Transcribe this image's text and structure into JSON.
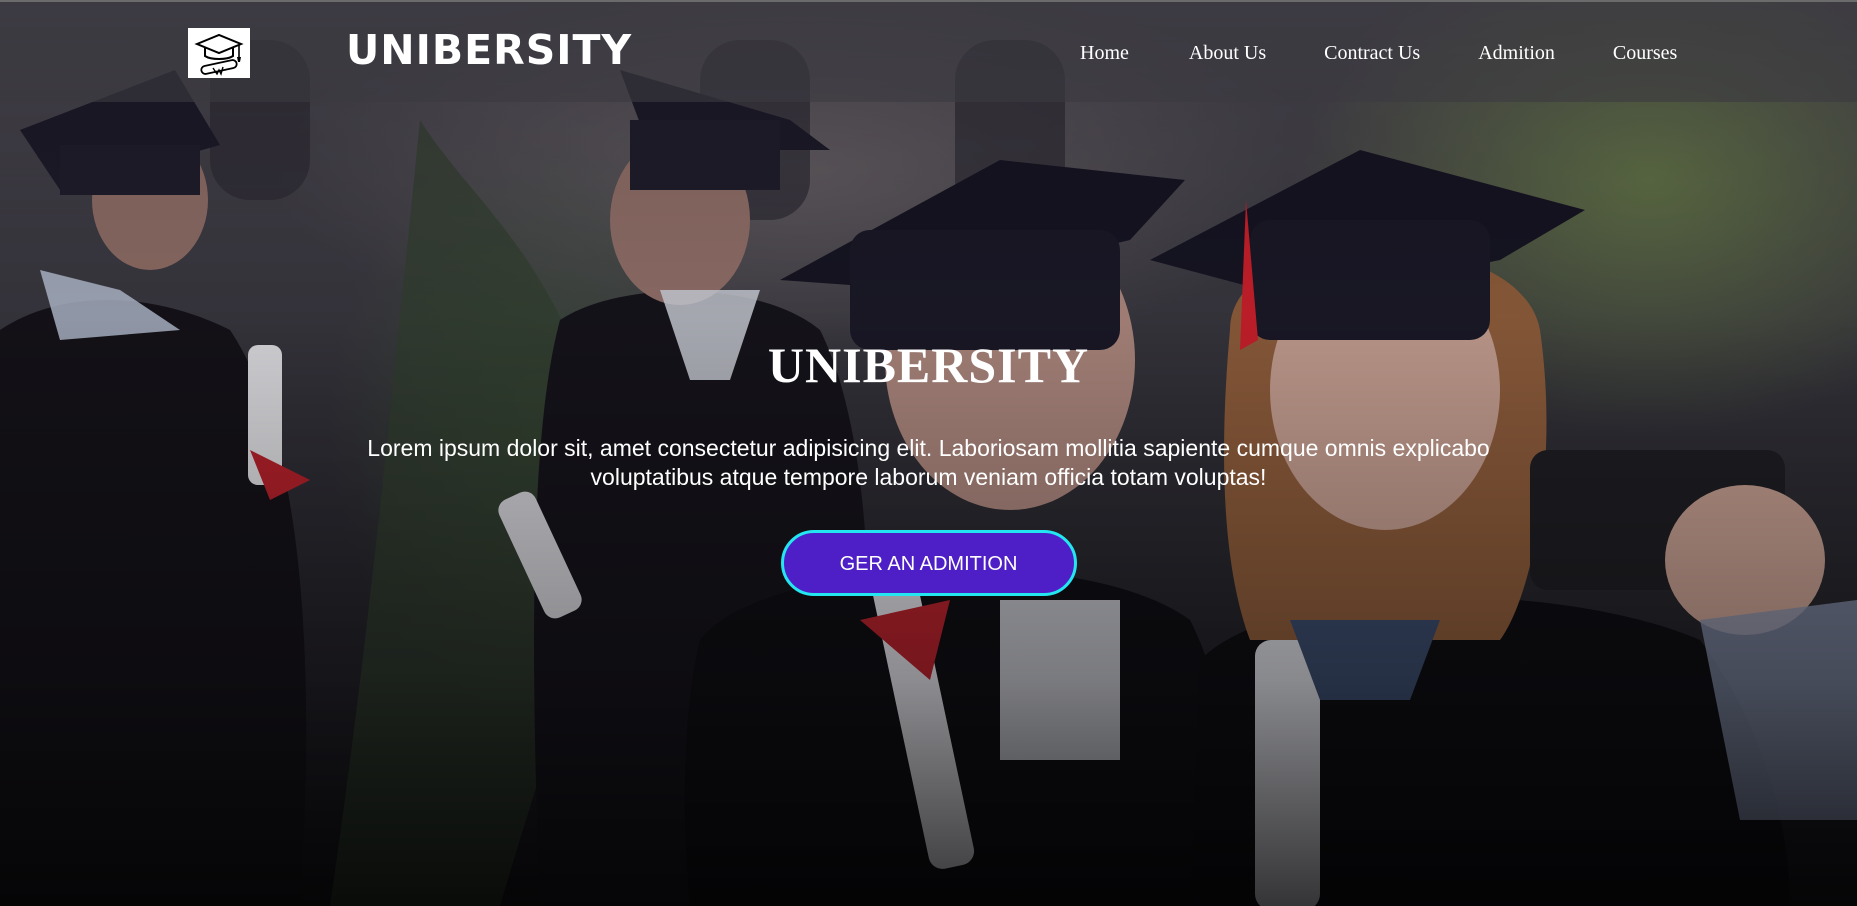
{
  "navbar": {
    "logo_icon": "graduation-cap-diploma-icon",
    "brand": "UNIBERSITY",
    "links": [
      {
        "label": "Home"
      },
      {
        "label": "About Us"
      },
      {
        "label": "Contract Us"
      },
      {
        "label": "Admition"
      },
      {
        "label": "Courses"
      }
    ]
  },
  "hero": {
    "title": "UNIBERSITY",
    "text": "Lorem ipsum dolor sit, amet consectetur adipisicing elit. Laboriosam mollitia sapiente cumque omnis explicabo voluptatibus atque tempore laborum veniam officia totam voluptas!",
    "cta_label": "GER AN ADMITION"
  },
  "colors": {
    "cta_background": "#4e1fc6",
    "cta_border": "#24e6f0",
    "text": "#ffffff"
  }
}
